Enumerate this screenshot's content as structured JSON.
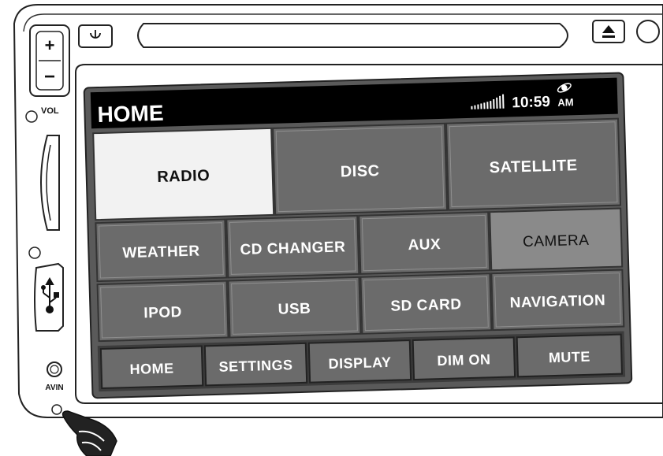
{
  "device": {
    "vol_label": "VOL",
    "avin_label": "AVIN",
    "vol_plus": "+",
    "vol_minus": "−"
  },
  "screen": {
    "title": "HOME",
    "clock_time": "10:59",
    "clock_ampm": "AM"
  },
  "menu": {
    "row1": [
      "RADIO",
      "DISC",
      "SATELLITE"
    ],
    "row2": [
      "WEATHER",
      "CD CHANGER",
      "AUX",
      "CAMERA"
    ],
    "row3": [
      "IPOD",
      "USB",
      "SD CARD",
      "NAVIGATION"
    ],
    "bottom": [
      "HOME",
      "SETTINGS",
      "DISPLAY",
      "DIM ON",
      "MUTE"
    ]
  },
  "colors": {
    "selected_button": "#f2f2f2",
    "button_face": "#6b6b6b",
    "screen_frame": "#5a5a5a",
    "title_bar": "#000000",
    "camera_button": "#8a8a8a"
  }
}
